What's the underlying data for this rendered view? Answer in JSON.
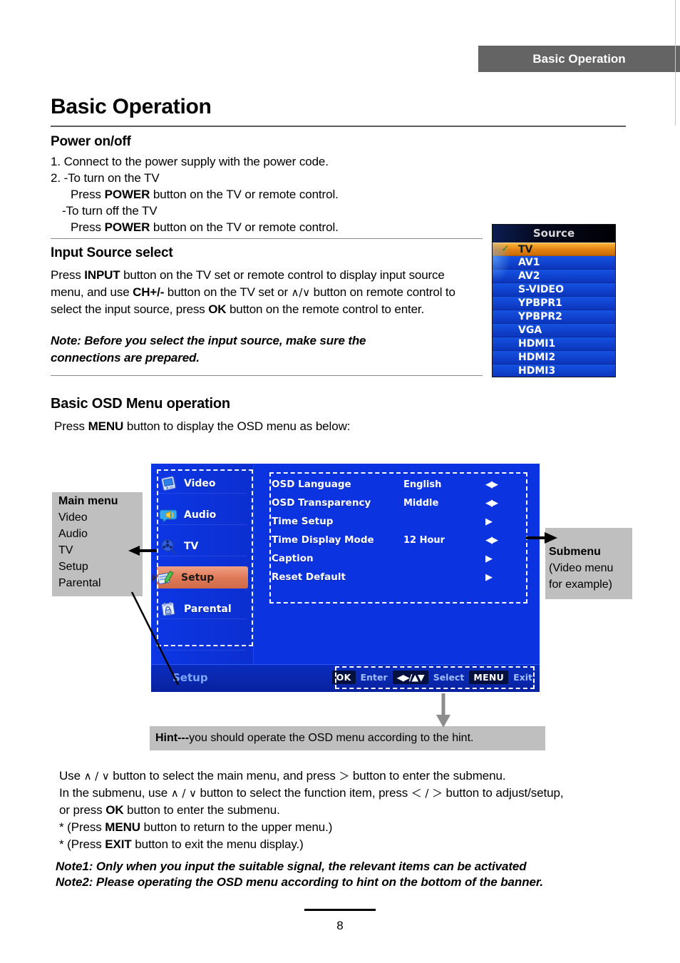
{
  "header": {
    "banner_title": "Basic Operation"
  },
  "page_title": "Basic Operation",
  "sections": {
    "power": {
      "heading": "Power on/off",
      "line1": "1. Connect to the power supply with the power code.",
      "line2": "2. -To turn on the TV",
      "line3_pre": "Press ",
      "line3_bold": "POWER",
      "line3_post": " button on the TV or remote control.",
      "line4": "-To turn off the TV",
      "line5_pre": "Press ",
      "line5_bold": "POWER",
      "line5_post": " button on the TV or remote control."
    },
    "input_source": {
      "heading": "Input Source select",
      "p_a": "Press ",
      "p_b": "INPUT",
      "p_c": " button on the TV set or remote control to display input source menu, and use ",
      "p_d": "CH+/-",
      "p_e": " button on the TV set or ",
      "p_f": "∧/∨",
      "p_g": "  button on remote control to select the input source, press ",
      "p_h": "OK",
      "p_i": " button on the remote control to enter.",
      "note": "Note: Before you select the input source, make sure the connections are prepared."
    },
    "osd": {
      "heading": "Basic OSD Menu operation",
      "intro_pre": "Press ",
      "intro_bold": "MENU",
      "intro_post": " button to display the OSD menu as below:"
    }
  },
  "source_menu": {
    "title": "Source",
    "check_glyph": "✓",
    "items": [
      {
        "label": "TV",
        "selected": true
      },
      {
        "label": "AV1",
        "selected": false
      },
      {
        "label": "AV2",
        "selected": false
      },
      {
        "label": "S-VIDEO",
        "selected": false
      },
      {
        "label": "YPBPR1",
        "selected": false
      },
      {
        "label": "YPBPR2",
        "selected": false
      },
      {
        "label": "VGA",
        "selected": false
      },
      {
        "label": "HDMI1",
        "selected": false
      },
      {
        "label": "HDMI2",
        "selected": false
      },
      {
        "label": "HDMI3",
        "selected": false
      }
    ],
    "colors": {
      "row_blue": "#1552e2",
      "selected_orange": "#e07f12",
      "header_black": "#000005"
    }
  },
  "osd_menu": {
    "sidebar": [
      {
        "label": "Video",
        "icon": "video-icon",
        "active": false
      },
      {
        "label": "Audio",
        "icon": "audio-icon",
        "active": false
      },
      {
        "label": "TV",
        "icon": "tv-icon",
        "active": false
      },
      {
        "label": "Setup",
        "icon": "setup-icon",
        "active": true
      },
      {
        "label": "Parental",
        "icon": "parental-icon",
        "active": false
      }
    ],
    "options": [
      {
        "name": "OSD Language",
        "value": "English",
        "control": "◀▶"
      },
      {
        "name": "OSD Transparency",
        "value": "Middle",
        "control": "◀▶"
      },
      {
        "name": "Time Setup",
        "value": "",
        "control": "▶"
      },
      {
        "name": "Time Display Mode",
        "value": "12 Hour",
        "control": "◀▶"
      },
      {
        "name": "Caption",
        "value": "",
        "control": "▶"
      },
      {
        "name": "Reset Default",
        "value": "",
        "control": "▶"
      }
    ],
    "breadcrumb": "Setup",
    "hintbar": {
      "ok_key": "OK",
      "ok_text": "Enter",
      "arrows_key": "◀▶/▲▼",
      "arrows_text": "Select",
      "menu_key": "MENU",
      "menu_text": "Exit"
    },
    "colors": {
      "background_blue": "#0c33e0",
      "active_orange": "#e07a59",
      "bottom_bar": "#0a28ad"
    }
  },
  "annotations": {
    "main_menu": {
      "title": "Main menu",
      "items": [
        "Video",
        "Audio",
        "TV",
        "Setup",
        "Parental"
      ]
    },
    "submenu": {
      "title": "Submenu",
      "line2": "(Video menu",
      "line3": "for example)"
    },
    "hint": {
      "bold": "Hint---",
      "text": "you should operate the OSD menu according to the hint."
    }
  },
  "instructions": {
    "l1_a": "Use ",
    "l1_b": "∧ / ∨",
    "l1_c": " button to select the main menu, and press ",
    "l1_d": "＞",
    "l1_e": " button to enter the submenu.",
    "l2_a": "In the submenu, use ",
    "l2_b": "∧ / ∨",
    "l2_c": "  button to select the function item, press ",
    "l2_d": "＜ / ＞",
    "l2_e": " button to adjust/setup,",
    "l3_a": "or press ",
    "l3_b": "OK",
    "l3_c": " button to enter the submenu.",
    "l4_a": "* (Press ",
    "l4_b": "MENU",
    "l4_c": " button to return to the upper menu.)",
    "l5_a": "* (Press ",
    "l5_b": "EXIT",
    "l5_c": " button to exit the menu display.)"
  },
  "notes": {
    "note1": "Note1: Only when you input the suitable signal, the relevant items can be activated",
    "note2": "Note2: Please operating the OSD menu according to hint on the bottom of the banner."
  },
  "footer": {
    "page_number": "8"
  }
}
